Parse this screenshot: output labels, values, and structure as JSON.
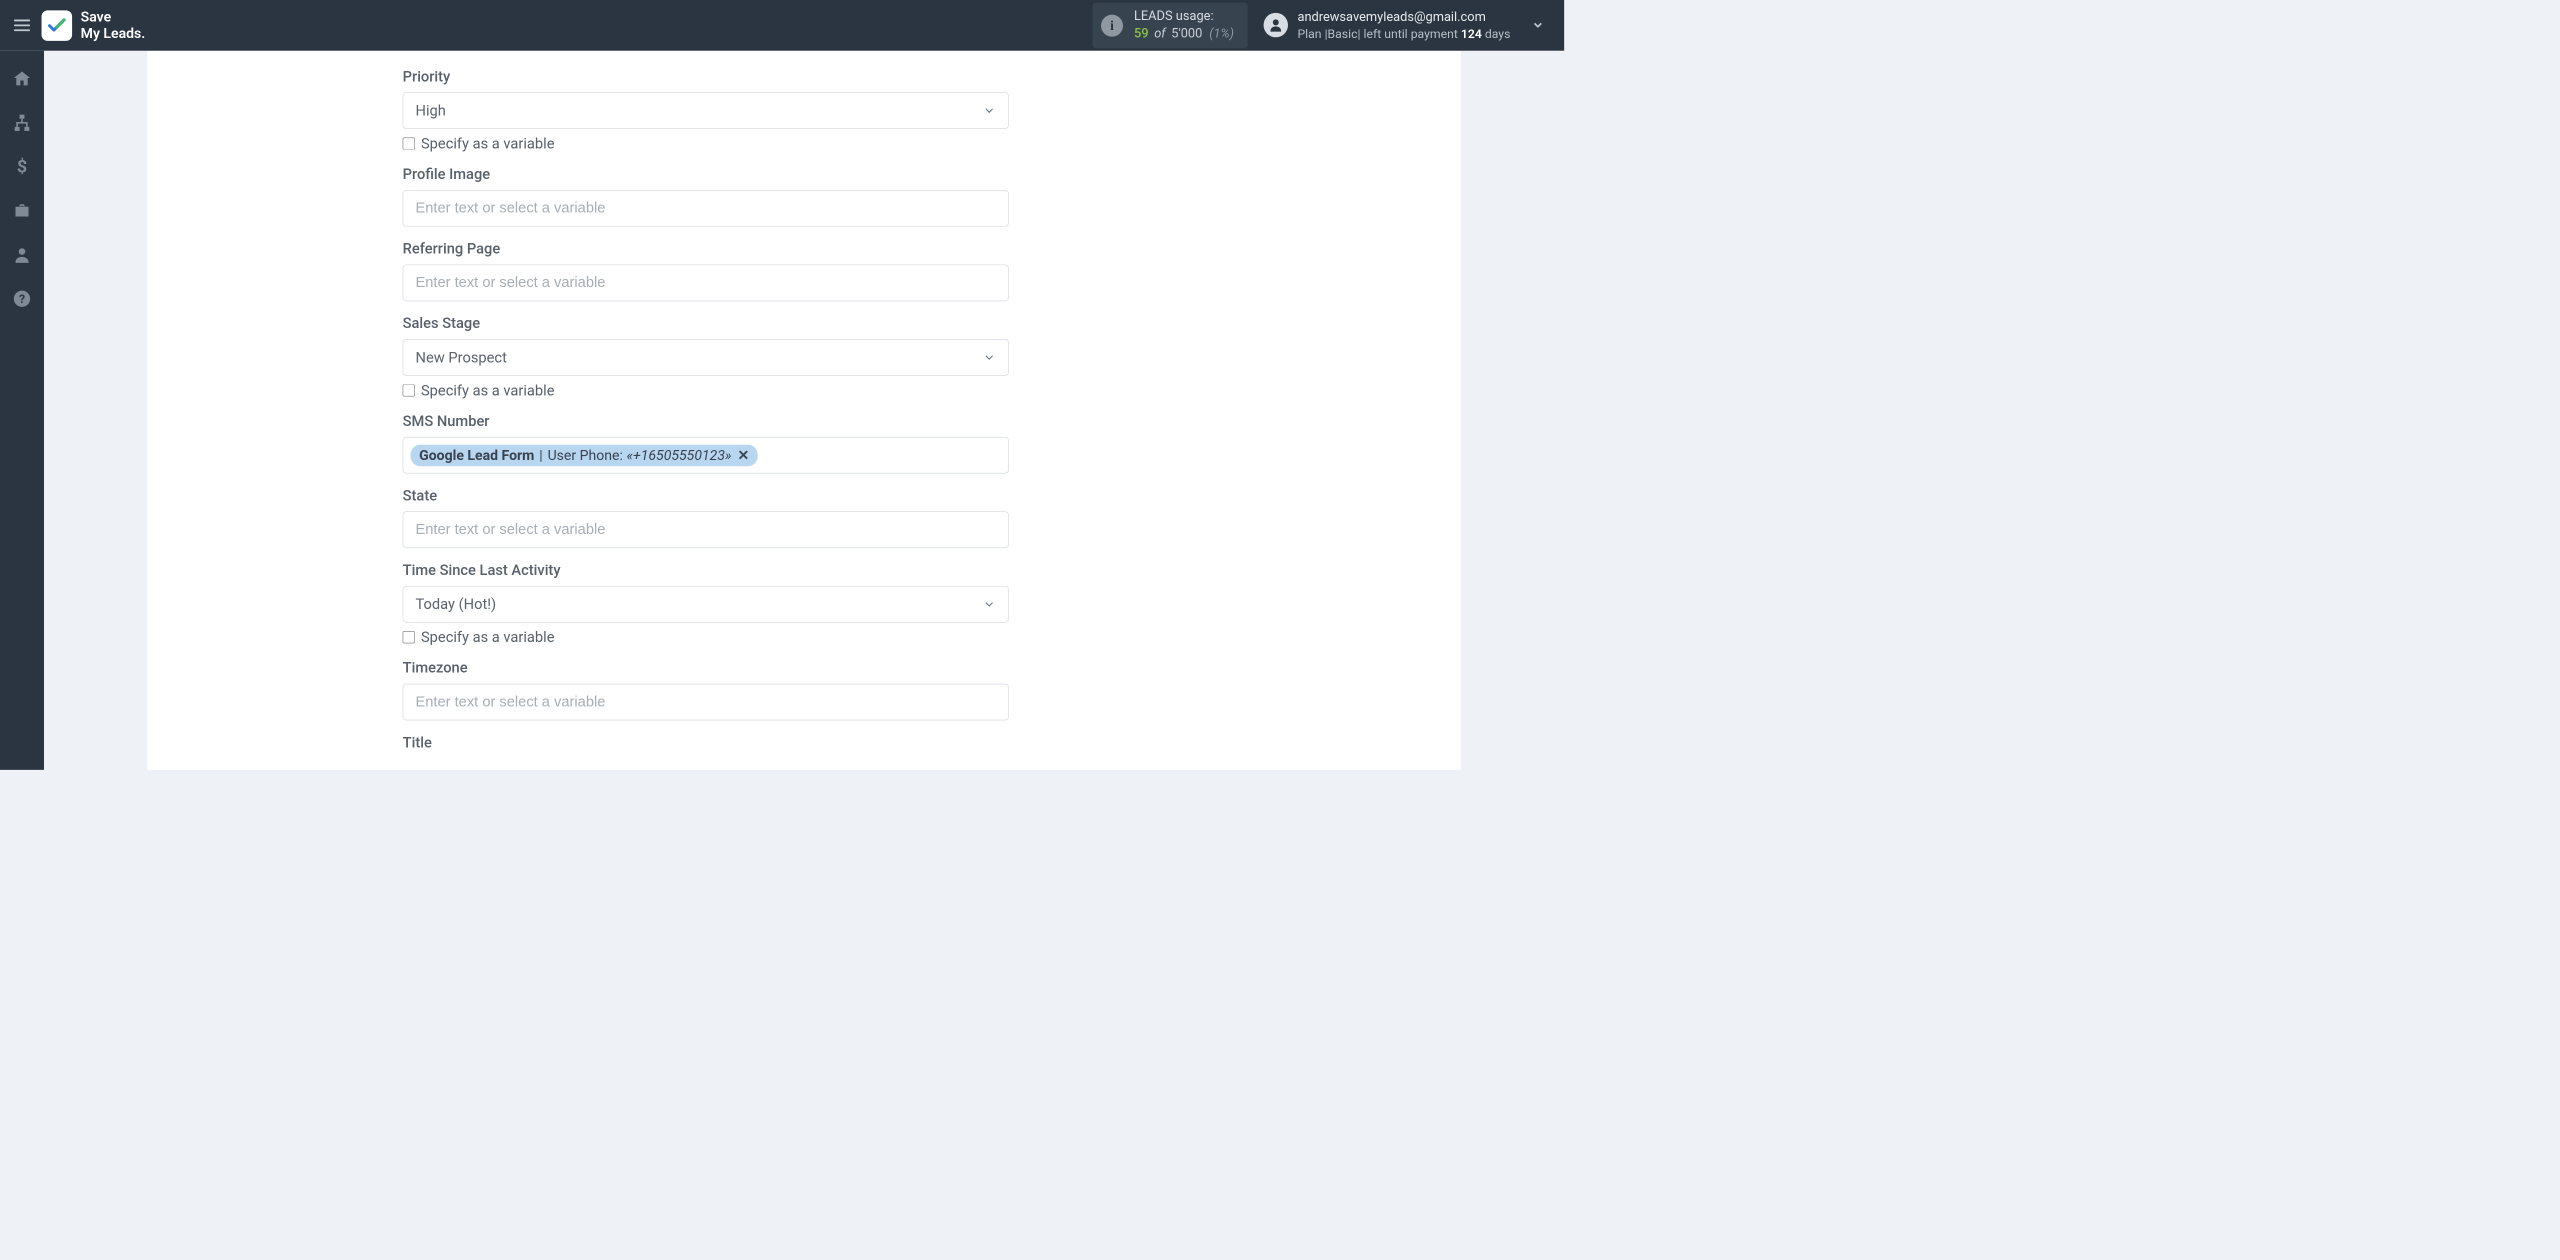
{
  "brand": {
    "line1": "Save",
    "line2": "My Leads."
  },
  "usage": {
    "label": "LEADS usage:",
    "used": "59",
    "of": "of",
    "total": "5'000",
    "pct": "(1%)"
  },
  "account": {
    "email": "andrewsavemyleads@gmail.com",
    "plan_prefix": "Plan |",
    "plan_name": "Basic",
    "plan_mid": "| left until payment ",
    "days": "124",
    "plan_suffix": " days"
  },
  "form": {
    "variable_placeholder": "Enter text or select a variable",
    "specify_as_variable": "Specify as a variable",
    "priority": {
      "label": "Priority",
      "value": "High"
    },
    "profile_image": {
      "label": "Profile Image"
    },
    "referring_page": {
      "label": "Referring Page"
    },
    "sales_stage": {
      "label": "Sales Stage",
      "value": "New Prospect"
    },
    "sms_number": {
      "label": "SMS Number",
      "chip_source": "Google Lead Form",
      "chip_field": "User Phone:",
      "chip_value": "«+16505550123»"
    },
    "state": {
      "label": "State"
    },
    "time_since": {
      "label": "Time Since Last Activity",
      "value": "Today (Hot!)"
    },
    "timezone": {
      "label": "Timezone"
    },
    "title": {
      "label": "Title"
    }
  }
}
